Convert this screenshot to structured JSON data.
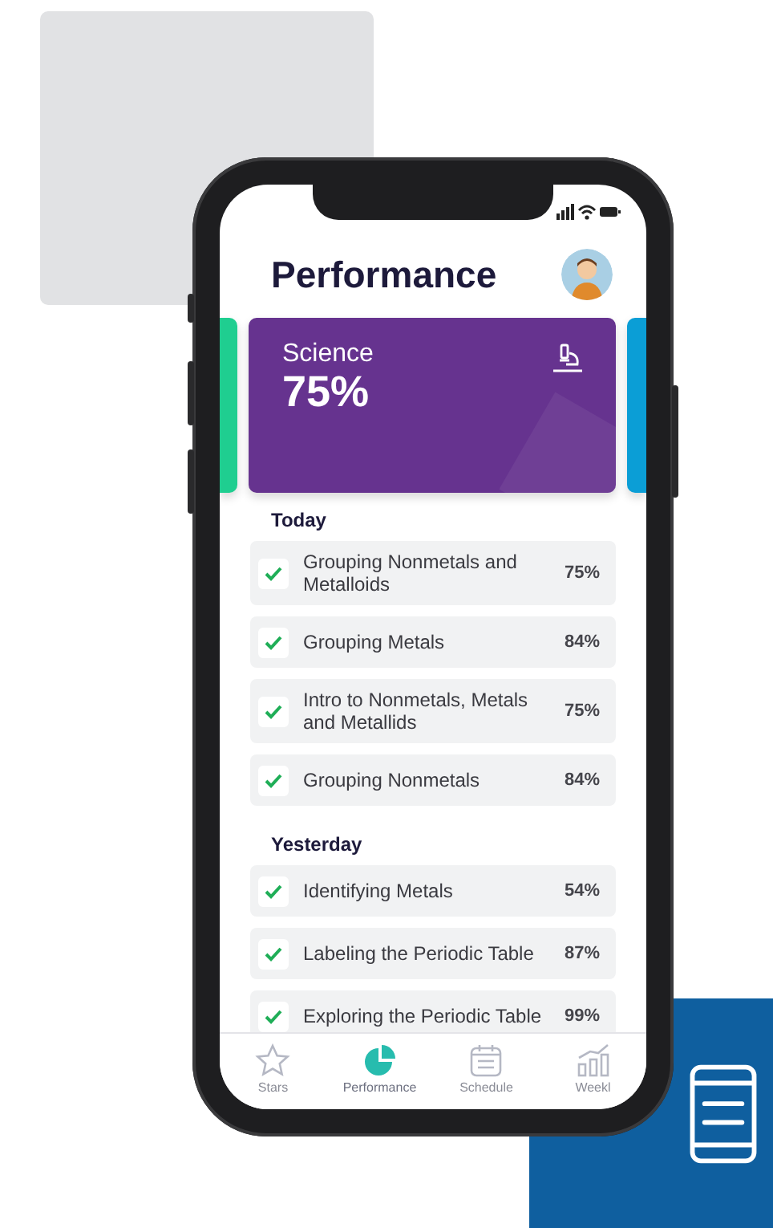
{
  "header": {
    "title": "Performance"
  },
  "subject_cards": [
    {
      "kind": "peek",
      "color": "#1fce90"
    },
    {
      "kind": "full",
      "subject": "Science",
      "score": "75%",
      "color": "#66338f"
    },
    {
      "kind": "peek",
      "color": "#0b9ed6"
    }
  ],
  "sections": [
    {
      "heading": "Today",
      "lessons": [
        {
          "title": "Grouping Nonmetals and Metalloids",
          "score": "75%",
          "completed": true
        },
        {
          "title": "Grouping Metals",
          "score": "84%",
          "completed": true
        },
        {
          "title": "Intro to Nonmetals, Metals and Metallids",
          "score": "75%",
          "completed": true
        },
        {
          "title": "Grouping Nonmetals",
          "score": "84%",
          "completed": true
        }
      ]
    },
    {
      "heading": "Yesterday",
      "lessons": [
        {
          "title": "Identifying Metals",
          "score": "54%",
          "completed": true
        },
        {
          "title": "Labeling the Periodic Table",
          "score": "87%",
          "completed": true
        },
        {
          "title": "Exploring the Periodic Table",
          "score": "99%",
          "completed": true
        }
      ]
    }
  ],
  "tabs": [
    {
      "label": "Stars",
      "selected": false
    },
    {
      "label": "Performance",
      "selected": true
    },
    {
      "label": "Schedule",
      "selected": false
    },
    {
      "label": "Weekl",
      "selected": false
    }
  ]
}
